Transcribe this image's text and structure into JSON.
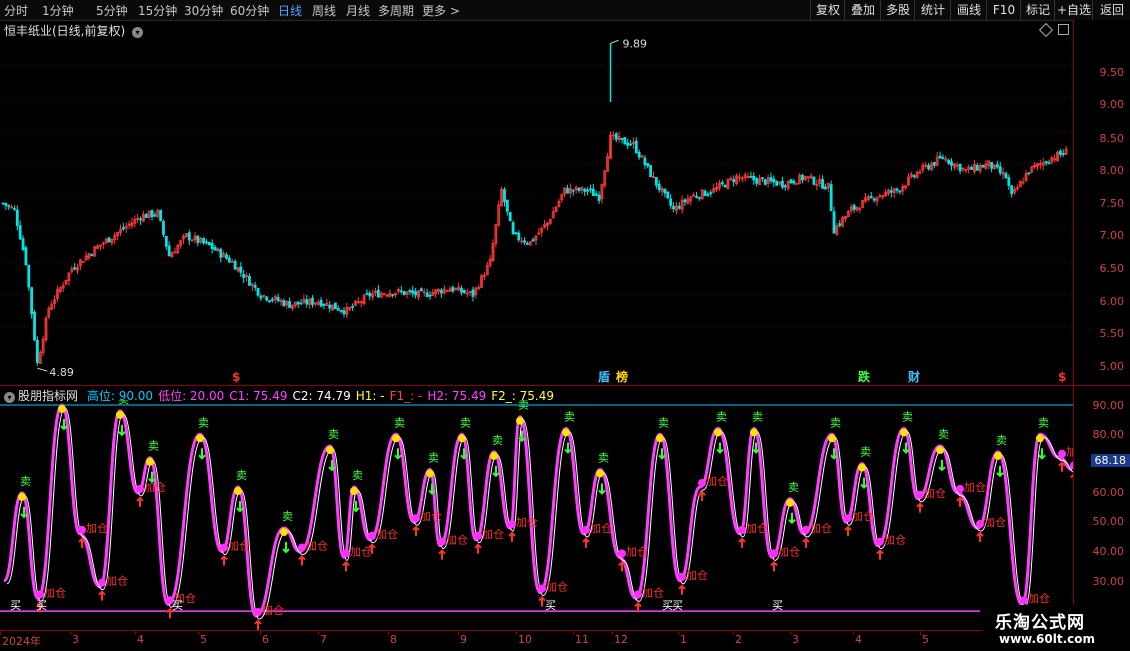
{
  "toolbar": {
    "periods": [
      "分时",
      "1分钟",
      "5分钟",
      "15分钟",
      "30分钟",
      "60分钟",
      "日线",
      "周线",
      "月线",
      "多周期",
      "更多 >"
    ],
    "active_period": "日线",
    "buttons": [
      "复权",
      "叠加",
      "多股",
      "统计",
      "画线",
      "F10",
      "标记",
      "+自选",
      "返回"
    ]
  },
  "main_panel": {
    "title": "恒丰纸业(日线,前复权)",
    "y_ticks": [
      "9.50",
      "9.00",
      "8.50",
      "8.00",
      "7.50",
      "7.00",
      "6.50",
      "6.00",
      "5.50",
      "5.00"
    ],
    "high_label": "9.89",
    "low_label": "4.89",
    "markers": [
      {
        "text": "$",
        "color": "#ff3030"
      },
      {
        "text": "盾",
        "color": "#40c0ff"
      },
      {
        "text": "榜",
        "color": "#ffd700"
      },
      {
        "text": "跌",
        "color": "#40ff40"
      },
      {
        "text": "财",
        "color": "#40c0ff"
      },
      {
        "text": "$",
        "color": "#ff3030"
      }
    ]
  },
  "indicator_panel": {
    "name": "股朋指标网",
    "params": [
      {
        "label": "高位: 90.00",
        "color": "#00c8ff"
      },
      {
        "label": "低位: 20.00",
        "color": "#ff40ff"
      },
      {
        "label": "C1: 75.49",
        "color": "#ff40ff"
      },
      {
        "label": "C2: 74.79",
        "color": "#ffffff"
      },
      {
        "label": "H1: -",
        "color": "#ffff40"
      },
      {
        "label": "F1_: -",
        "color": "#ff4040"
      },
      {
        "label": "H2: 75.49",
        "color": "#ff40ff"
      },
      {
        "label": "F2_: 75.49",
        "color": "#ffff40"
      }
    ],
    "y_ticks": [
      "90.00",
      "80.00",
      "68.18",
      "60.00",
      "50.00",
      "40.00",
      "30.00"
    ],
    "current_value": "68.18",
    "sell_label": "卖",
    "add_label": "加仓",
    "buy_label": "买"
  },
  "x_axis": [
    "2024年",
    "3",
    "4",
    "5",
    "6",
    "7",
    "8",
    "9",
    "10",
    "11",
    "12",
    "1",
    "2",
    "3",
    "4",
    "5"
  ],
  "watermark": {
    "title": "乐淘公式网",
    "url": "www.60lt.com"
  },
  "colors": {
    "up": "#ff3a3a",
    "down": "#00e5e5",
    "indicator_line": "#ff40ff",
    "indicator_line2": "#ffffff",
    "high_line": "#00c8ff",
    "low_line": "#ff40ff",
    "axis": "#c44"
  }
}
